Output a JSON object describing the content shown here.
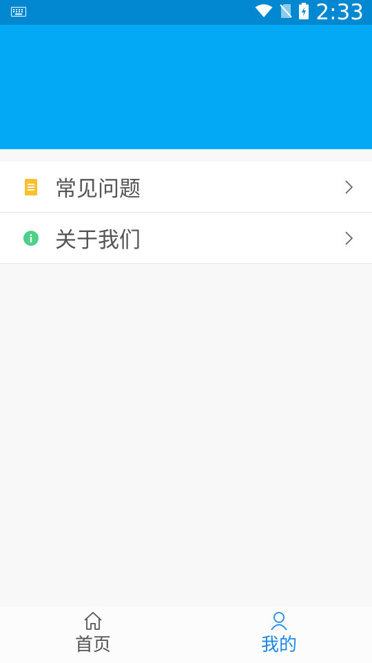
{
  "status_bar": {
    "time": "2:33",
    "icons": [
      "keyboard-icon",
      "wifi-icon",
      "no-sim-icon",
      "battery-charging-icon"
    ]
  },
  "colors": {
    "status_bar": "#0288d1",
    "header": "#03a9f4",
    "active_tab": "#1e88e5",
    "faq_icon": "#fbc02d",
    "about_icon": "#4fd08a"
  },
  "menu": {
    "items": [
      {
        "label": "常见问题",
        "icon": "document-icon"
      },
      {
        "label": "关于我们",
        "icon": "info-icon"
      }
    ]
  },
  "bottom_nav": {
    "tabs": [
      {
        "label": "首页",
        "icon": "home-icon",
        "active": false
      },
      {
        "label": "我的",
        "icon": "user-icon",
        "active": true
      }
    ]
  }
}
